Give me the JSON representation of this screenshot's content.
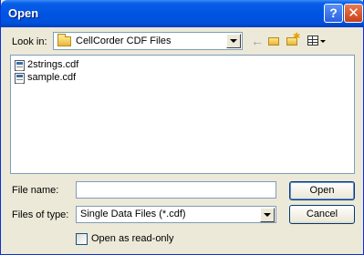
{
  "window": {
    "title": "Open",
    "help_glyph": "?",
    "close_glyph": "✕"
  },
  "lookin": {
    "label": "Look in:",
    "value": "CellCorder CDF Files"
  },
  "toolbar": {
    "back_glyph": "←"
  },
  "files": [
    {
      "name": "2strings.cdf"
    },
    {
      "name": "sample.cdf"
    }
  ],
  "filename": {
    "label": "File name:",
    "value": ""
  },
  "filetype": {
    "label": "Files of type:",
    "value": "Single Data Files (*.cdf)"
  },
  "buttons": {
    "open": "Open",
    "cancel": "Cancel"
  },
  "readonly": {
    "label": "Open as read-only",
    "checked": false
  },
  "colors": {
    "titlebar": "#0054e3",
    "dialog": "#ece9d8",
    "border": "#7f9db9"
  }
}
